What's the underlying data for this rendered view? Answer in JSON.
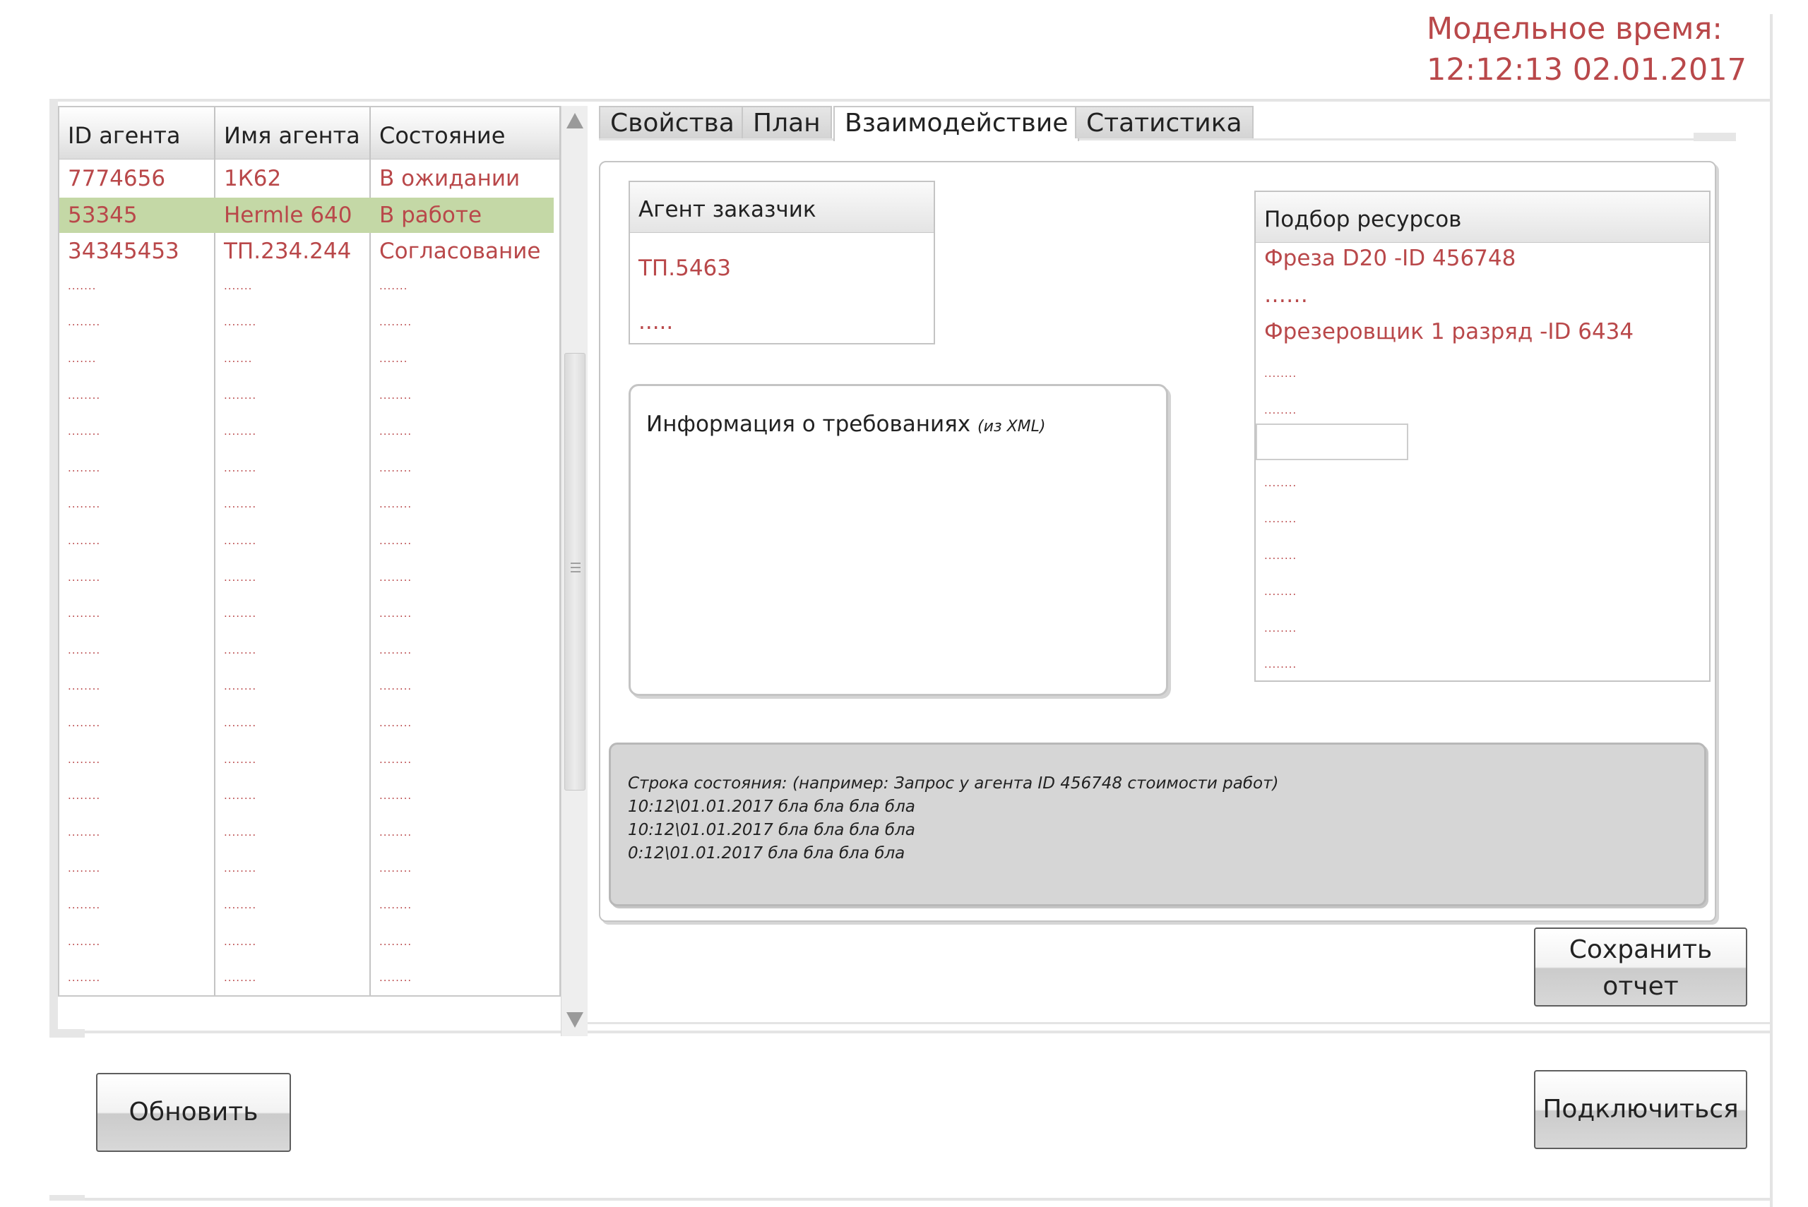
{
  "model_time": {
    "label": "Модельное время:",
    "value": "12:12:13 02.01.2017"
  },
  "agents_table": {
    "columns": [
      "ID агента",
      "Имя агента",
      "Состояние"
    ],
    "rows": [
      [
        "7774656",
        "1К62",
        "В ожидании"
      ],
      [
        "53345",
        "Hermle 640",
        "В работе"
      ],
      [
        "34345453",
        "ТП.234.244",
        "Согласование"
      ],
      [
        ".......",
        ".......",
        "......."
      ],
      [
        "........",
        "........",
        "........"
      ],
      [
        ".......",
        ".......",
        "......."
      ],
      [
        "........",
        "........",
        "........"
      ],
      [
        "........",
        "........",
        "........"
      ],
      [
        "........",
        "........",
        "........"
      ],
      [
        "........",
        "........",
        "........"
      ],
      [
        "........",
        "........",
        "........"
      ],
      [
        "........",
        "........",
        "........"
      ],
      [
        "........",
        "........",
        "........"
      ],
      [
        "........",
        "........",
        "........"
      ],
      [
        "........",
        "........",
        "........"
      ],
      [
        "........",
        "........",
        "........"
      ],
      [
        "........",
        "........",
        "........"
      ],
      [
        "........",
        "........",
        "........"
      ],
      [
        "........",
        "........",
        "........"
      ],
      [
        "........",
        "........",
        "........"
      ],
      [
        "........",
        "........",
        "........"
      ],
      [
        "........",
        "........",
        "........"
      ],
      [
        "........",
        "........",
        "........"
      ],
      [
        "........",
        "........",
        "........"
      ]
    ],
    "selected_row": 1
  },
  "tabs": [
    "Свойства",
    "План",
    "Взаимодействие",
    "Статистика"
  ],
  "active_tab": "Взаимодействие",
  "customer_agent": {
    "title": "Агент заказчик",
    "value": "ТП.5463",
    "more": "....."
  },
  "requirements": {
    "title": "Информация о требованиях",
    "note": "(из XML)"
  },
  "resources": {
    "title": "Подбор ресурсов",
    "item1": "Фреза D20 -ID 456748",
    "dots1": "……",
    "item2": "Фрезеровщик 1 разряд -ID 6434",
    "rest": [
      "........",
      "........",
      "........",
      "........",
      "........",
      "........",
      "........",
      "........",
      "........"
    ]
  },
  "status_log": [
    "Строка состояния: (например: Запрос у агента ID 456748 стоимости работ)",
    "10:12\\01.01.2017 бла бла бла бла",
    "10:12\\01.01.2017 бла бла бла бла",
    "0:12\\01.01.2017 бла бла бла бла"
  ],
  "buttons": {
    "save_line1": "Сохранить",
    "save_line2": "отчет",
    "refresh": "Обновить",
    "connect": "Подключиться"
  },
  "colors": {
    "accent_red": "#b9484a",
    "selected_row": "#c4d8a6",
    "status_bg": "#d6d6d6"
  }
}
